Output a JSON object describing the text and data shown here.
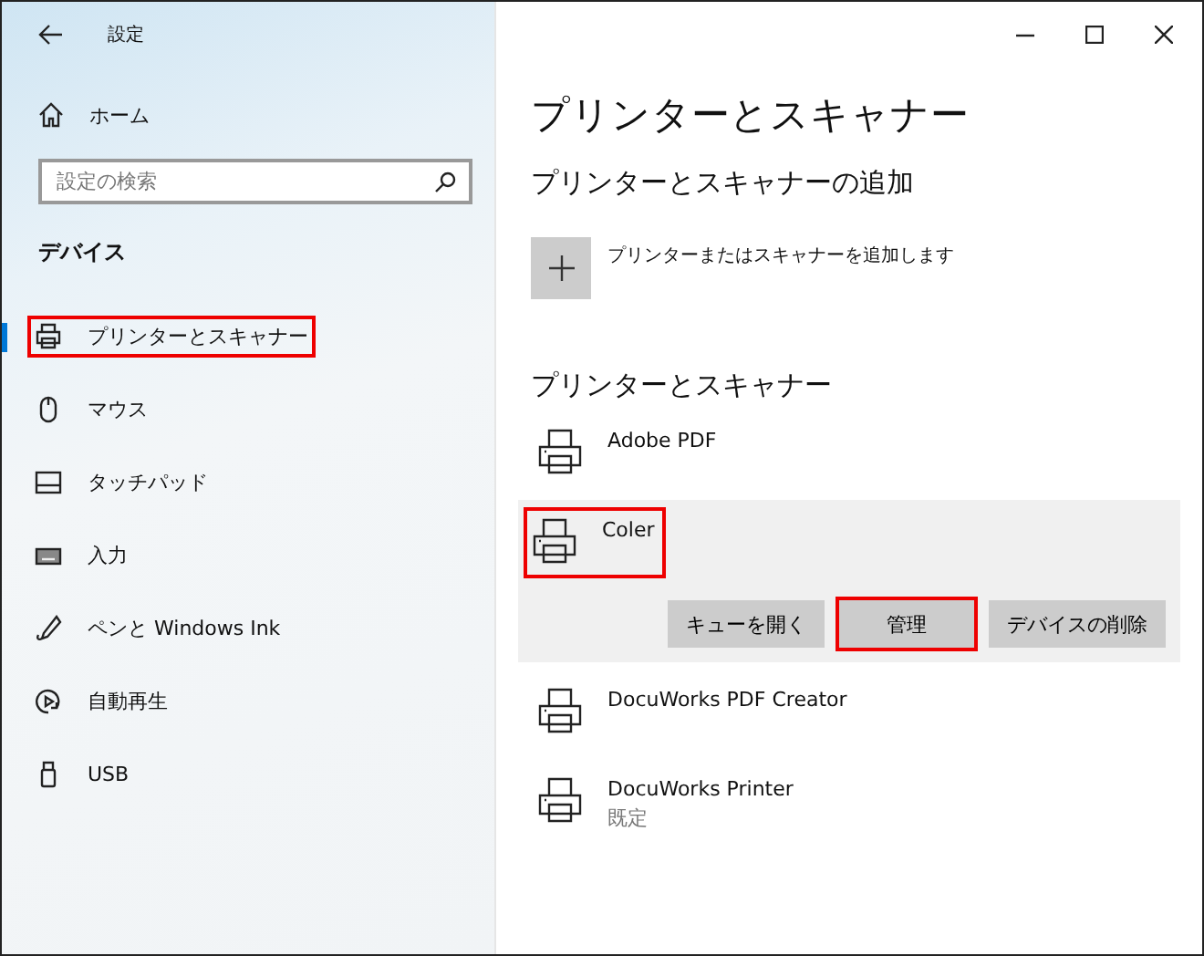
{
  "window": {
    "title": "設定"
  },
  "sidebar": {
    "home": "ホーム",
    "search": {
      "placeholder": "設定の検索"
    },
    "section": "デバイス",
    "items": [
      {
        "label": "プリンターとスキャナー",
        "selected": true,
        "highlighted": true
      },
      {
        "label": "マウス",
        "selected": false,
        "highlighted": false
      },
      {
        "label": "タッチパッド",
        "selected": false,
        "highlighted": false
      },
      {
        "label": "入力",
        "selected": false,
        "highlighted": false
      },
      {
        "label": "ペンと Windows Ink",
        "selected": false,
        "highlighted": false
      },
      {
        "label": "自動再生",
        "selected": false,
        "highlighted": false
      },
      {
        "label": "USB",
        "selected": false,
        "highlighted": false
      }
    ]
  },
  "main": {
    "title": "プリンターとスキャナー",
    "add_heading": "プリンターとスキャナーの追加",
    "add_label": "プリンターまたはスキャナーを追加します",
    "list_heading": "プリンターとスキャナー",
    "printers": [
      {
        "name": "Adobe PDF",
        "selected": false,
        "highlighted": false
      },
      {
        "name": "Coler",
        "selected": true,
        "highlighted": true,
        "buttons": [
          {
            "label": "キューを開く",
            "highlighted": false
          },
          {
            "label": "管理",
            "highlighted": true
          },
          {
            "label": "デバイスの削除",
            "highlighted": false
          }
        ]
      },
      {
        "name": "DocuWorks PDF Creator",
        "selected": false,
        "highlighted": false
      },
      {
        "name": "DocuWorks Printer",
        "status": "既定",
        "selected": false,
        "highlighted": false
      }
    ]
  }
}
